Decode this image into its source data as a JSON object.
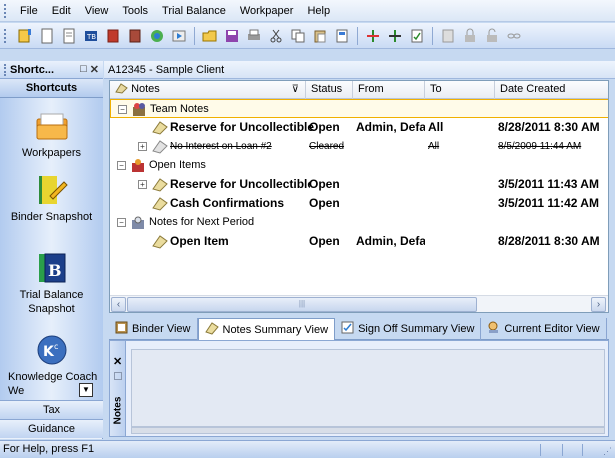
{
  "menu": [
    "File",
    "Edit",
    "View",
    "Tools",
    "Trial Balance",
    "Workpaper",
    "Help"
  ],
  "sidebar": {
    "header": "Shortc...",
    "header_buttons": [
      "□",
      "✕"
    ],
    "title": "Shortcuts",
    "shortcuts": [
      {
        "label": "Workpapers",
        "icon": "folder-workpapers-icon"
      },
      {
        "label": "Binder Snapshot",
        "icon": "binder-snapshot-icon"
      },
      {
        "label": "Trial Balance Snapshot",
        "icon": "trial-balance-snapshot-icon"
      },
      {
        "label": "Knowledge Coach We",
        "icon": "knowledge-coach-icon"
      }
    ],
    "footer_items": [
      "Tax",
      "Guidance"
    ]
  },
  "client_title": "A12345 - Sample Client",
  "grid": {
    "columns": [
      "Notes",
      "Status",
      "From",
      "To",
      "Date Created"
    ],
    "rows": [
      {
        "text": "Team Notes",
        "status": "",
        "from": "",
        "to": "",
        "date": "",
        "type": "group"
      },
      {
        "text": "Reserve for Uncollectible",
        "status": "Open",
        "from": "Admin, Defa",
        "to": "All",
        "date": "8/28/2011 8:30 AM",
        "type": "note"
      },
      {
        "text": "No Interest on Loan #2",
        "status": "Cleared",
        "from": "",
        "to": "All",
        "date": "8/5/2009 11:44 AM",
        "type": "cleared"
      },
      {
        "text": "Open Items",
        "status": "",
        "from": "",
        "to": "",
        "date": "",
        "type": "group"
      },
      {
        "text": "Reserve for Uncollectible",
        "status": "Open",
        "from": "",
        "to": "",
        "date": "3/5/2011 11:43 AM",
        "type": "note"
      },
      {
        "text": "Cash Confirmations",
        "status": "Open",
        "from": "",
        "to": "",
        "date": "3/5/2011 11:42 AM",
        "type": "note"
      },
      {
        "text": "Notes for Next Period",
        "status": "",
        "from": "",
        "to": "",
        "date": "",
        "type": "group"
      },
      {
        "text": "Open Item",
        "status": "Open",
        "from": "Admin, Defa",
        "to": "",
        "date": "8/28/2011 8:30 AM",
        "type": "note"
      }
    ]
  },
  "tabs": [
    "Binder View",
    "Notes Summary View",
    "Sign Off Summary View",
    "Current Editor View"
  ],
  "lower_panel": {
    "label": "Notes"
  },
  "status_text": "For Help, press F1",
  "colors": {
    "accent": "#c6d9f1",
    "selection_border": "#f0b000"
  }
}
